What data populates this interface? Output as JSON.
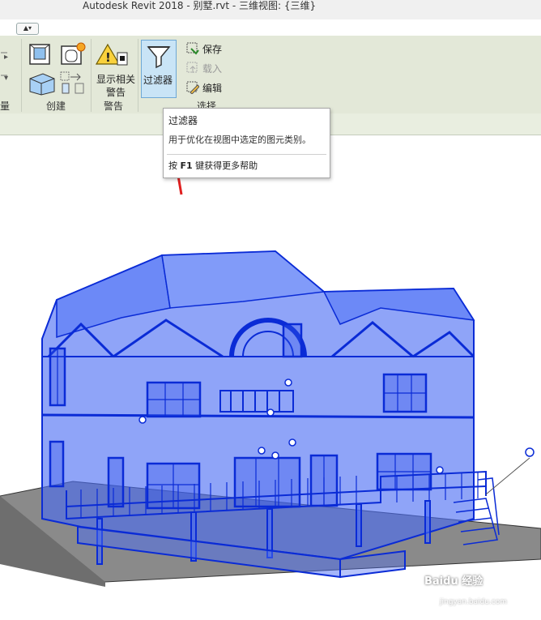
{
  "window": {
    "title": "Autodesk Revit 2018 -     别墅.rvt - 三维视图: {三维}"
  },
  "ribbon": {
    "groups": {
      "measure_partial": "量",
      "create": "创建",
      "warning": "警告",
      "selection": "选择"
    },
    "buttons": {
      "show_warnings_line1": "显示相关",
      "show_warnings_line2": "警告",
      "filter": "过滤器",
      "save": "保存",
      "load": "载入",
      "edit": "编辑"
    }
  },
  "tooltip": {
    "title": "过滤器",
    "description": "用于优化在视图中选定的图元类别。",
    "help_prefix": "按",
    "help_key": "F1",
    "help_suffix": "键获得更多帮助"
  },
  "watermark": {
    "text": "Baidu 经验",
    "sub": "jingyan.baidu.com"
  },
  "colors": {
    "model_fill": "#3a5ef0",
    "model_edge": "#0a2bd6",
    "ribbon_bg": "#e3e8d8",
    "highlight": "#c9e4f6",
    "annotation_arrow": "#e02020"
  }
}
